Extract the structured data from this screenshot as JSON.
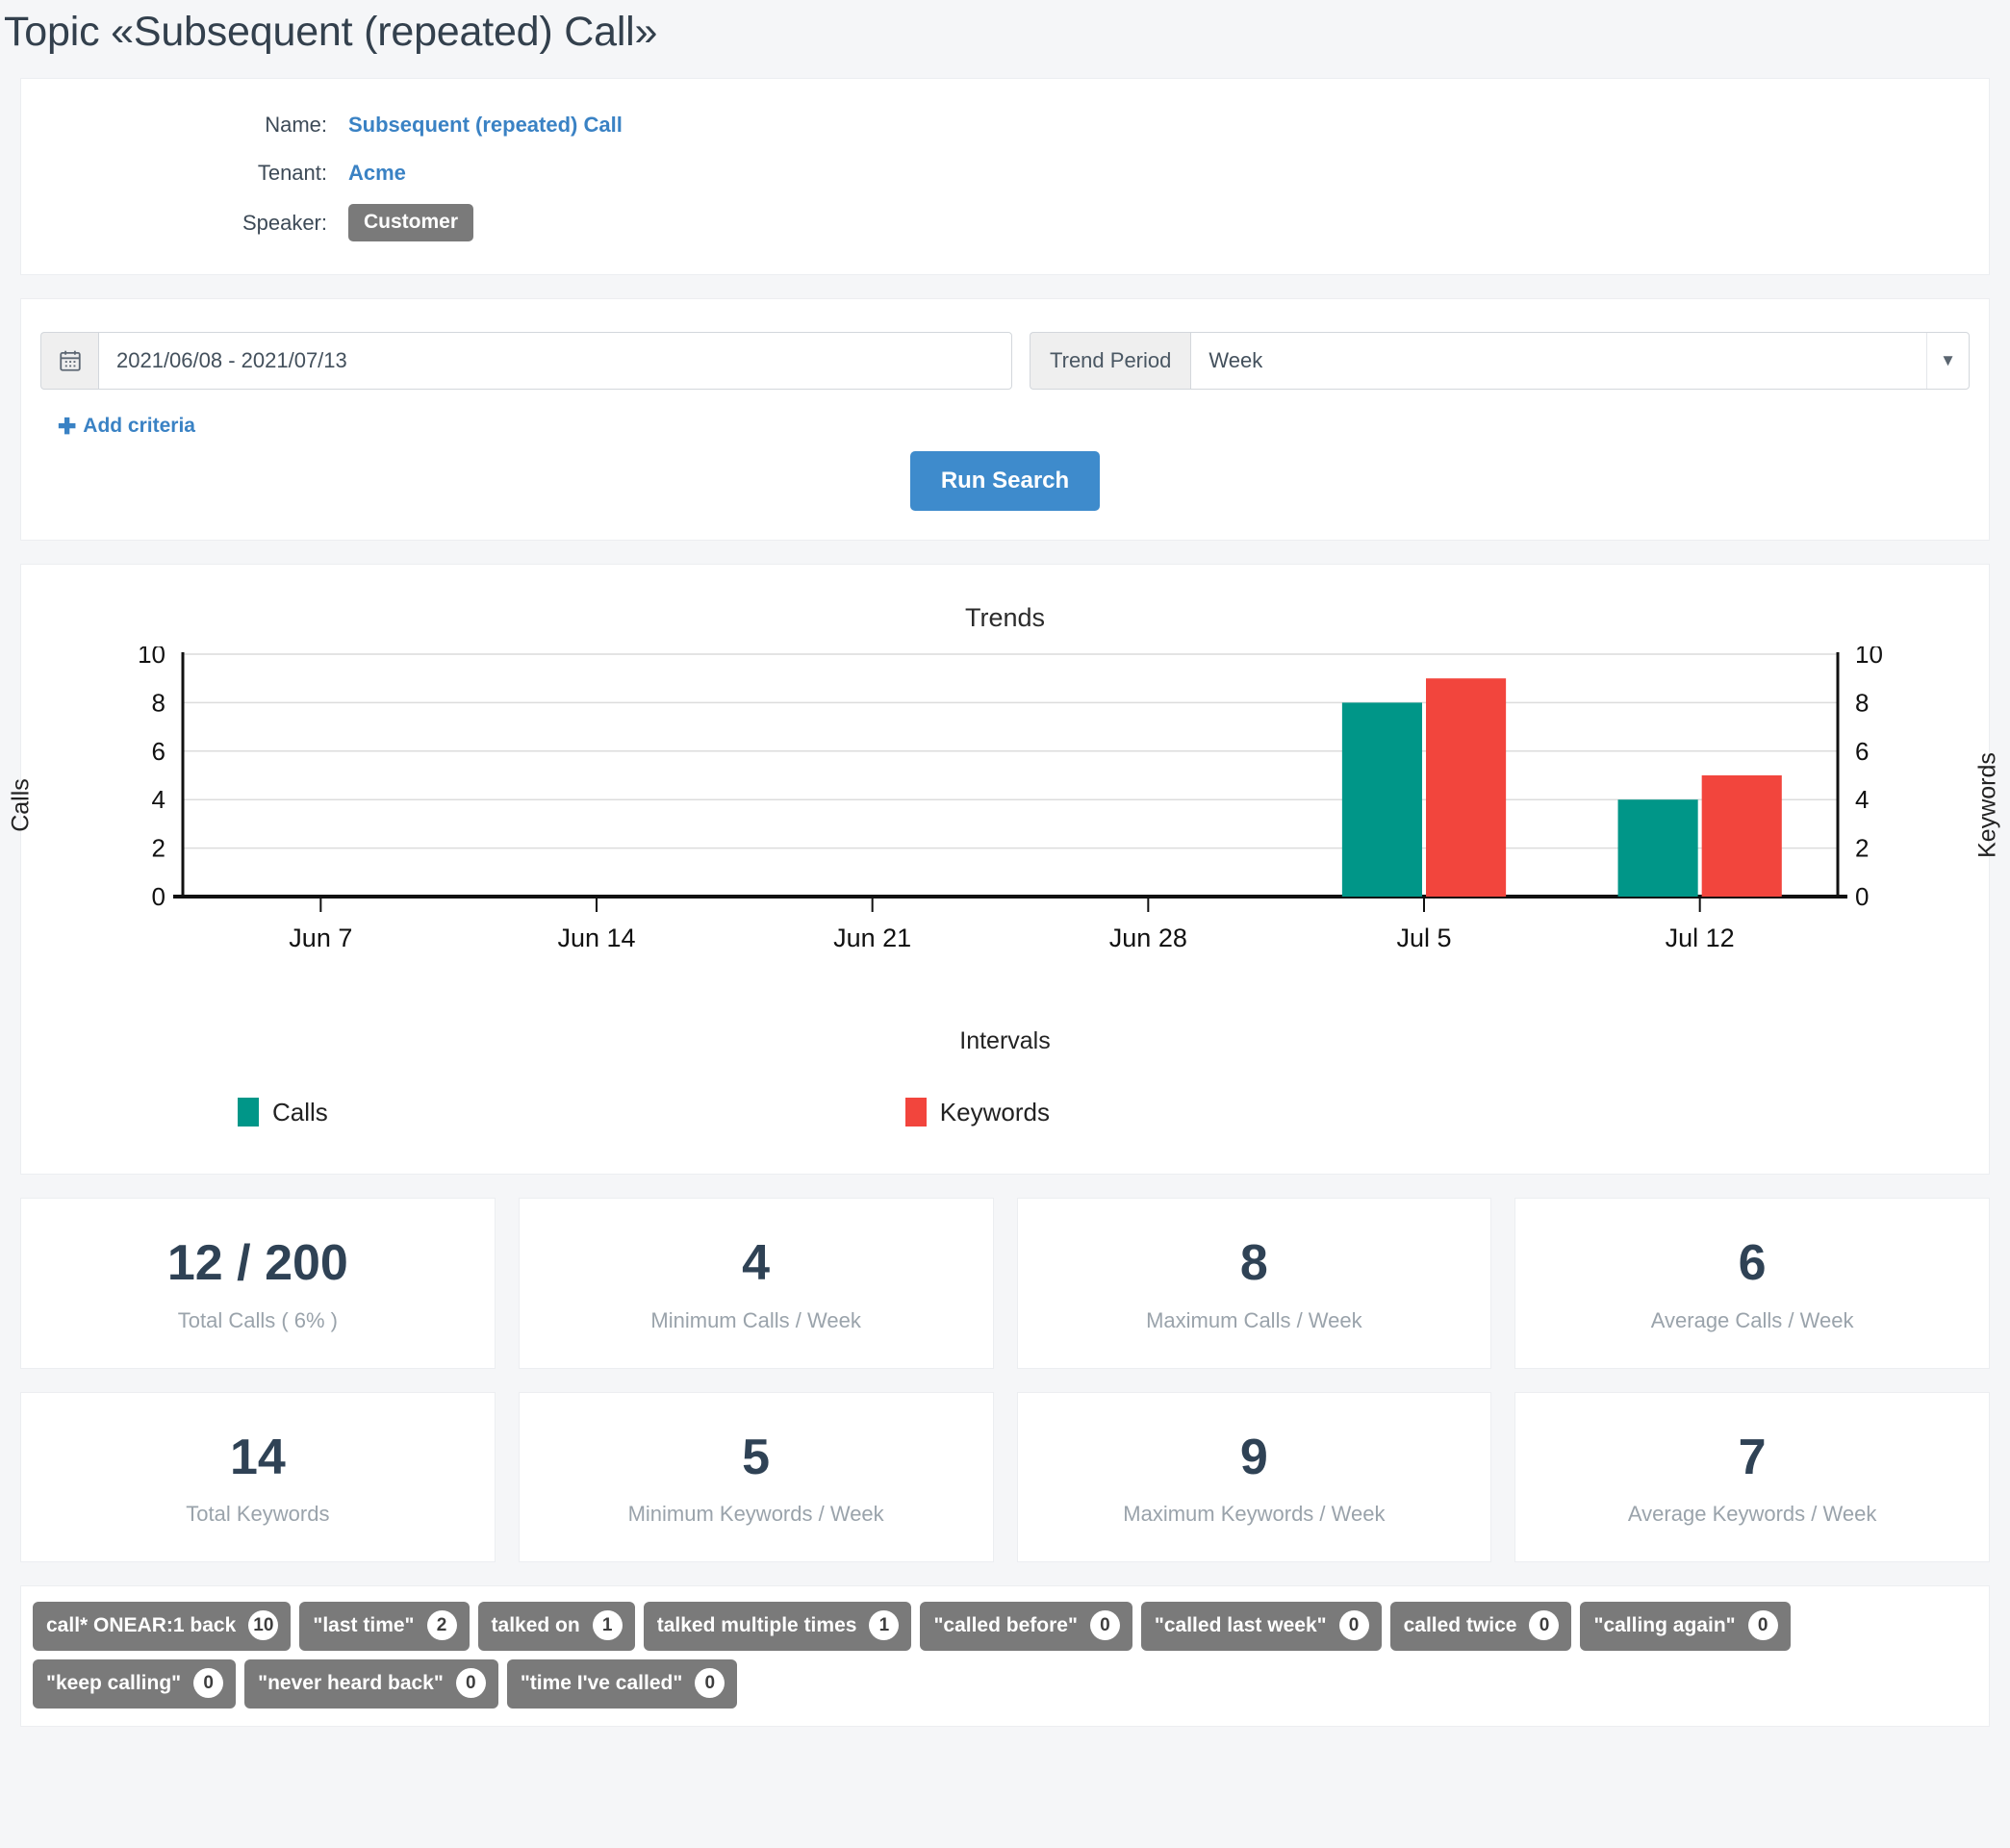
{
  "page": {
    "title": "Topic «Subsequent (repeated) Call»"
  },
  "meta": {
    "name_label": "Name:",
    "name_value": "Subsequent (repeated) Call",
    "tenant_label": "Tenant:",
    "tenant_value": "Acme",
    "speaker_label": "Speaker:",
    "speaker_value": "Customer"
  },
  "search": {
    "calendar_icon": "calendar-icon",
    "daterange_value": "2021/06/08 - 2021/07/13",
    "daterange_placeholder": "2021/06/08 - 2021/07/13",
    "trend_period_label": "Trend Period",
    "trend_period_value": "Week",
    "trend_caret_icon": "chevron-down-icon",
    "add_criteria_label": "Add criteria",
    "add_criteria_icon": "plus-icon",
    "run_search_label": "Run Search"
  },
  "chart_data": {
    "type": "bar",
    "title": "Trends",
    "xlabel": "Intervals",
    "ylabel": "Calls",
    "y2label": "Keywords",
    "categories": [
      "Jun 7",
      "Jun 14",
      "Jun 21",
      "Jun 28",
      "Jul 5",
      "Jul 12"
    ],
    "series": [
      {
        "name": "Calls",
        "color": "#009688",
        "values": [
          0,
          0,
          0,
          0,
          8,
          4
        ]
      },
      {
        "name": "Keywords",
        "color": "#F2453D",
        "values": [
          0,
          0,
          0,
          0,
          9,
          5
        ]
      }
    ],
    "ylim": [
      0,
      10
    ],
    "y2lim": [
      0,
      10
    ],
    "yticks": [
      0,
      2,
      4,
      6,
      8,
      10
    ],
    "y2ticks": [
      0,
      2,
      4,
      6,
      8,
      10
    ],
    "grid": true,
    "legend_position": "bottom"
  },
  "stats": {
    "row1": [
      {
        "value": "12 / 200",
        "label": "Total Calls ( 6% )"
      },
      {
        "value": "4",
        "label": "Minimum Calls / Week"
      },
      {
        "value": "8",
        "label": "Maximum Calls / Week"
      },
      {
        "value": "6",
        "label": "Average Calls / Week"
      }
    ],
    "row2": [
      {
        "value": "14",
        "label": "Total Keywords"
      },
      {
        "value": "5",
        "label": "Minimum Keywords / Week"
      },
      {
        "value": "9",
        "label": "Maximum Keywords / Week"
      },
      {
        "value": "7",
        "label": "Average Keywords / Week"
      }
    ]
  },
  "keywords": [
    {
      "label": "call* ONEAR:1 back",
      "count": "10"
    },
    {
      "label": "\"last time\"",
      "count": "2"
    },
    {
      "label": "talked on",
      "count": "1"
    },
    {
      "label": "talked multiple times",
      "count": "1"
    },
    {
      "label": "\"called before\"",
      "count": "0"
    },
    {
      "label": "\"called last week\"",
      "count": "0"
    },
    {
      "label": "called twice",
      "count": "0"
    },
    {
      "label": "\"calling again\"",
      "count": "0"
    },
    {
      "label": "\"keep calling\"",
      "count": "0"
    },
    {
      "label": "\"never heard back\"",
      "count": "0"
    },
    {
      "label": "\"time I've called\"",
      "count": "0"
    }
  ],
  "colors": {
    "calls": "#009688",
    "keywords": "#F2453D",
    "accent": "#3a82c4",
    "badge": "#7a7a7a"
  }
}
